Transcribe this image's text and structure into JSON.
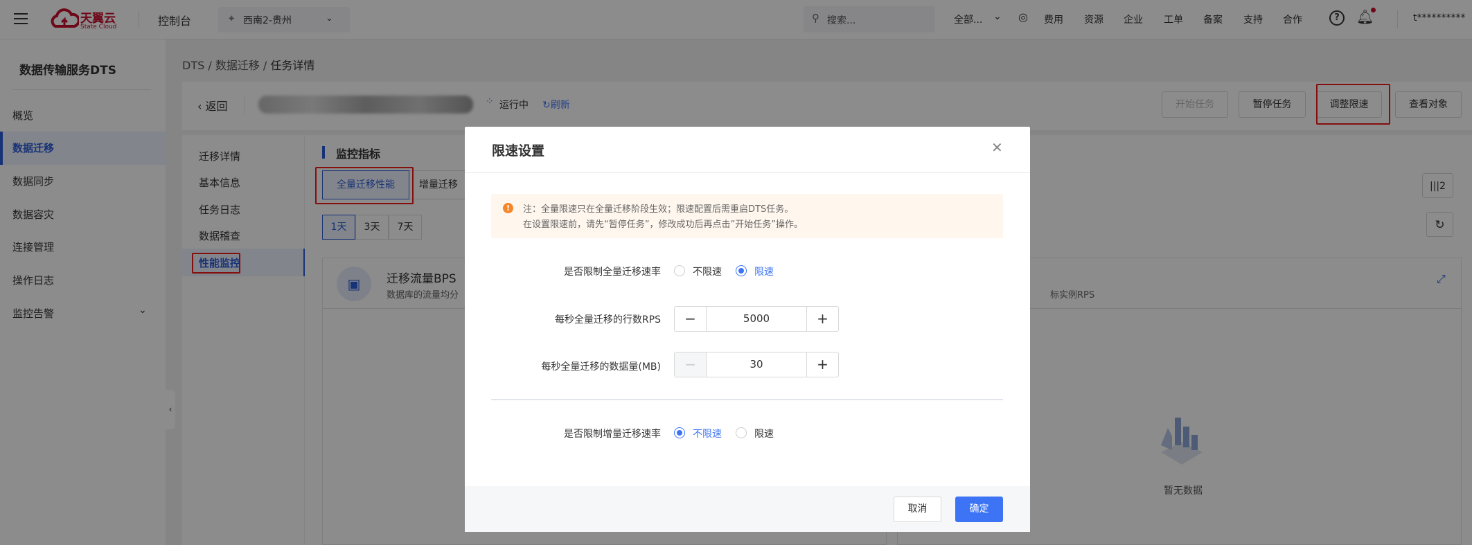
{
  "topbar": {
    "brand_cn": "天翼云",
    "brand_en": "State Cloud",
    "console": "控制台",
    "region": "西南2-贵州",
    "search_placeholder": "搜索...",
    "scope": "全部...",
    "nav": [
      "费用",
      "资源",
      "企业",
      "工单",
      "备案",
      "支持",
      "合作"
    ],
    "user": "t**********"
  },
  "sidebar": {
    "title": "数据传输服务DTS",
    "items": [
      {
        "label": "概览"
      },
      {
        "label": "数据迁移",
        "active": true
      },
      {
        "label": "数据同步"
      },
      {
        "label": "数据容灾"
      },
      {
        "label": "连接管理"
      },
      {
        "label": "操作日志"
      },
      {
        "label": "监控告警"
      }
    ]
  },
  "breadcrumb": [
    "DTS",
    "数据迁移",
    "任务详情"
  ],
  "task": {
    "back": "返回",
    "status": "运行中",
    "refresh": "刷新",
    "actions": {
      "start": "开始任务",
      "pause": "暂停任务",
      "adjust": "调整限速",
      "view": "查看对象"
    }
  },
  "subnav": [
    "迁移详情",
    "基本信息",
    "任务日志",
    "数据稽查",
    "性能监控"
  ],
  "monitor": {
    "title": "监控指标",
    "tabs": [
      "全量迁移性能",
      "增量迁移"
    ],
    "ranges": [
      "1天",
      "3天",
      "7天"
    ],
    "columns_btn": "|||2",
    "chart1": {
      "title": "迁移流量BPS",
      "subtitle": "数据库的流量均分"
    },
    "chart2": {
      "subtitle": "标实例RPS",
      "empty": "暂无数据"
    }
  },
  "dialog": {
    "title": "限速设置",
    "notice": [
      "注：全量限速只在全量迁移阶段生效；限速配置后需重启DTS任务。",
      "在设置限速前，请先“暂停任务”，修改成功后再点击”开始任务”操作。"
    ],
    "full_limit": {
      "label": "是否限制全量迁移速率",
      "options": [
        "不限速",
        "限速"
      ],
      "selected": "限速"
    },
    "rps": {
      "label": "每秒全量迁移的行数RPS",
      "value": "5000"
    },
    "mb": {
      "label": "每秒全量迁移的数据量(MB)",
      "value": "30"
    },
    "incr_limit": {
      "label": "是否限制增量迁移速率",
      "options": [
        "不限速",
        "限速"
      ],
      "selected": "不限速"
    },
    "cancel": "取消",
    "ok": "确定"
  },
  "colors": {
    "accent": "#3d74f5",
    "highlight": "#f01c1c",
    "warning": "#f5862a"
  }
}
